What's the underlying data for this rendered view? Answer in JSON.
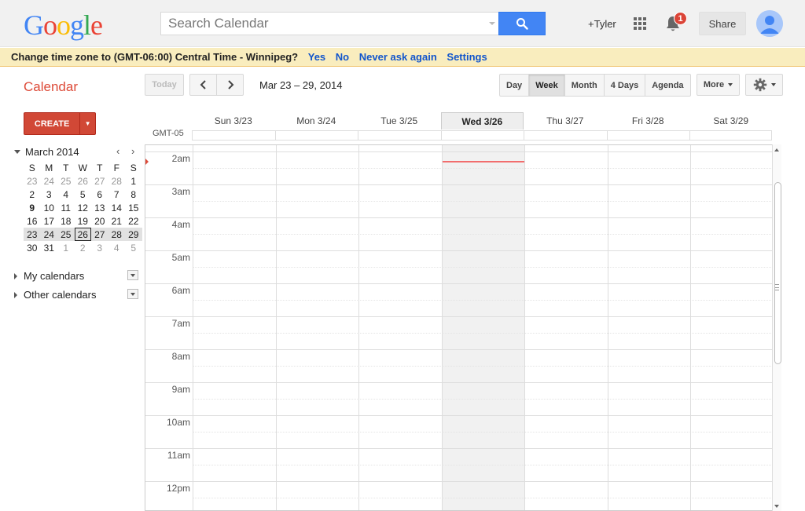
{
  "logo": {
    "text": "Google",
    "letters": [
      {
        "ch": "G",
        "color": "#4285f4"
      },
      {
        "ch": "o",
        "color": "#ea4335"
      },
      {
        "ch": "o",
        "color": "#fbbc05"
      },
      {
        "ch": "g",
        "color": "#4285f4"
      },
      {
        "ch": "l",
        "color": "#34a853"
      },
      {
        "ch": "e",
        "color": "#ea4335"
      }
    ]
  },
  "search": {
    "placeholder": "Search Calendar",
    "button_icon": "magnifier-icon"
  },
  "header": {
    "user": "+Tyler",
    "apps_icon": "apps-grid-icon",
    "notification_count": "1",
    "share_label": "Share"
  },
  "banner": {
    "message": "Change time zone to (GMT-06:00) Central Time - Winnipeg?",
    "links": [
      "Yes",
      "No",
      "Never ask again",
      "Settings"
    ]
  },
  "toolbar": {
    "app_title": "Calendar",
    "today_label": "Today",
    "prev_icon": "chevron-left-icon",
    "next_icon": "chevron-right-icon",
    "date_range": "Mar 23 – 29, 2014",
    "views": [
      "Day",
      "Week",
      "Month",
      "4 Days",
      "Agenda"
    ],
    "selected_view": "Week",
    "more_label": "More",
    "settings_icon": "gear-icon"
  },
  "sidebar": {
    "create_label": "CREATE",
    "mini_calendar": {
      "month_label": "March 2014",
      "weekdays": [
        "S",
        "M",
        "T",
        "W",
        "T",
        "F",
        "S"
      ],
      "weeks": [
        [
          "23",
          "24",
          "25",
          "26",
          "27",
          "28",
          "1"
        ],
        [
          "2",
          "3",
          "4",
          "5",
          "6",
          "7",
          "8"
        ],
        [
          "9",
          "10",
          "11",
          "12",
          "13",
          "14",
          "15"
        ],
        [
          "16",
          "17",
          "18",
          "19",
          "20",
          "21",
          "22"
        ],
        [
          "23",
          "24",
          "25",
          "26",
          "27",
          "28",
          "29"
        ],
        [
          "30",
          "31",
          "1",
          "2",
          "3",
          "4",
          "5"
        ]
      ],
      "today": "26"
    },
    "calendar_lists": [
      "My calendars",
      "Other calendars"
    ]
  },
  "week": {
    "timezone_label": "GMT-05",
    "days": [
      "Sun 3/23",
      "Mon 3/24",
      "Tue 3/25",
      "Wed 3/26",
      "Thu 3/27",
      "Fri 3/28",
      "Sat 3/29"
    ],
    "today_index": 3,
    "hours": [
      "2am",
      "3am",
      "4am",
      "5am",
      "6am",
      "7am",
      "8am",
      "9am",
      "10am",
      "11am",
      "12pm"
    ]
  }
}
